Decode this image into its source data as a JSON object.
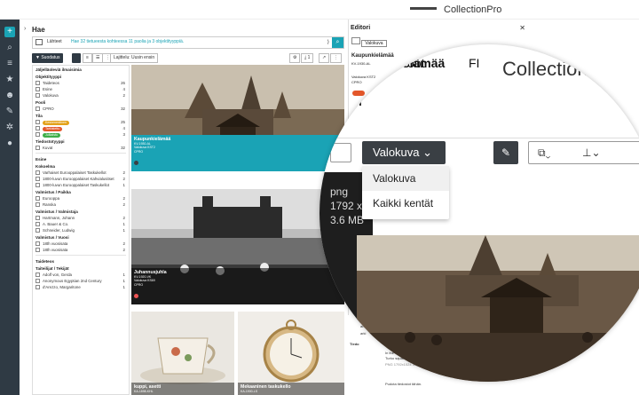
{
  "app": {
    "brand": "CollectionPro",
    "section_title": "Hae"
  },
  "search": {
    "scope_label": "Lähteet",
    "hint": "Hae 32 tietueesta kohteessa 11 paolia ja 3 objektityyppiä.",
    "submit_icon": "search-icon"
  },
  "toolbar": {
    "filter_label": "Suodatus",
    "sort_label": "Lajittelu: Uusin ensin",
    "count_label": "1"
  },
  "facets": {
    "filter_heading": "Jäljelläoleviä ilmaisimia",
    "groups": [
      {
        "title": "Objektityyppi",
        "items": [
          {
            "label": "Taideteos",
            "count": "26"
          },
          {
            "label": "Esine",
            "count": "4"
          },
          {
            "label": "Valokuva",
            "count": "2"
          }
        ]
      },
      {
        "title": "Pooli",
        "items": [
          {
            "label": "CPRO",
            "count": "32"
          }
        ]
      },
      {
        "title": "Tila",
        "items": [
          {
            "label": "Keskeneräinen",
            "count": "25",
            "color": "#e3a21a"
          },
          {
            "label": "Tarkistettu",
            "count": "4",
            "color": "#e3572a"
          },
          {
            "label": "Julkaistu",
            "count": "3",
            "color": "#3fae49"
          }
        ]
      },
      {
        "title": "Tiedostotyyppi",
        "items": [
          {
            "label": "Kuvat",
            "count": "32"
          }
        ]
      },
      {
        "title": "Kokoelma",
        "items": [
          {
            "label": "Varhaiset Eurooppalaiset Taskukellot",
            "count": "2"
          },
          {
            "label": "1800-luvun Eurooppalaiset Kahvialusitset",
            "count": "2"
          },
          {
            "label": "1800-luvun Eurooppalaiset Taskukellot",
            "count": "1"
          }
        ]
      },
      {
        "title": "Valmistus / Paikka",
        "items": [
          {
            "label": "Eurooppa",
            "count": "2"
          },
          {
            "label": "Ranska",
            "count": "2"
          }
        ]
      },
      {
        "title": "Valmistus / Valmistaja",
        "items": [
          {
            "label": "Hartmann, Johann",
            "count": "2"
          },
          {
            "label": "A. Bauer & Co.",
            "count": "1"
          },
          {
            "label": "Schneider, Ludwig",
            "count": "1"
          }
        ]
      },
      {
        "title": "Valmistus / Vuosi",
        "items": [
          {
            "label": "18th vuosisata",
            "count": "2"
          },
          {
            "label": "18th vuosisata",
            "count": "2"
          }
        ]
      },
      {
        "title": "Taiteilijat / Tekijät",
        "items": [
          {
            "label": "Adolf von, Gerda",
            "count": "1"
          },
          {
            "label": "Anonymous Egyptian 2nd Century",
            "count": "1"
          },
          {
            "label": "d'Arezzo, Margaritone",
            "count": "1"
          }
        ]
      }
    ],
    "other_heading": "Esine",
    "taideteos_heading": "Taideteos"
  },
  "cards": [
    {
      "title": "Kaupunkielämää",
      "id": "KV-1930-AL",
      "meta": "Valokuva KST2",
      "pool": "CPRO"
    },
    {
      "title": "Juhannusjuhla",
      "id": "KV-1920-VK",
      "meta": "Valokuva KS69",
      "pool": "CPRO"
    },
    {
      "title": "kuppi, asetti",
      "id": "KA-1898-KHL"
    },
    {
      "title": "Mekaaninen taskukello",
      "id": "KA-1900-LS"
    }
  ],
  "editor": {
    "title": "Editori",
    "close_icon": "close-icon",
    "record_title": "Kaupunkielämää",
    "record_id": "KV-1930-AL",
    "record_meta": "Valokuva KST2",
    "record_pool": "CPRO",
    "owner": "root",
    "lang": "FI",
    "subtitle_fragment": "ori",
    "type_select": "Valokuva",
    "dropdown_options": [
      "Valokuva",
      "Kaikki kentät"
    ],
    "file_ext": "png",
    "file_dims": "1792 x",
    "file_size": "3.6 MB",
    "lower_rows": [
      "arkielama",
      "arki",
      "Tiedo",
      "In the early 1900s, a",
      "Turku square. The scene inclu",
      "PNG 1792x1024 3.7 MB",
      "Pudota tiedostot tähän."
    ]
  }
}
